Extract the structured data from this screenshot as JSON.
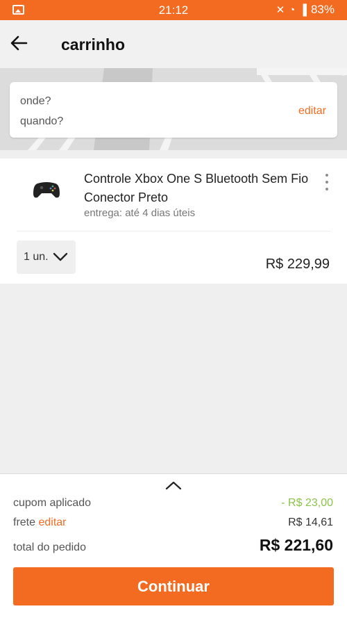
{
  "status_bar": {
    "time": "21:12",
    "battery": "83%"
  },
  "header": {
    "title": "carrinho"
  },
  "delivery": {
    "where_label": "onde?",
    "when_label": "quando?",
    "edit_label": "editar"
  },
  "item": {
    "name": "Controle Xbox One S Bluetooth Sem Fio Conector Preto",
    "delivery_text": "entrega: até 4 dias úteis",
    "quantity": "1 un.",
    "price": "R$ 229,99"
  },
  "summary": {
    "coupon_label": "cupom aplicado",
    "coupon_value": "- R$ 23,00",
    "shipping_label": "frete",
    "shipping_edit": "editar",
    "shipping_value": "R$ 14,61",
    "total_label": "total do pedido",
    "total_value": "R$ 221,60"
  },
  "actions": {
    "continue_label": "Continuar"
  },
  "colors": {
    "accent": "#f26b21",
    "discount": "#8bc34a"
  }
}
